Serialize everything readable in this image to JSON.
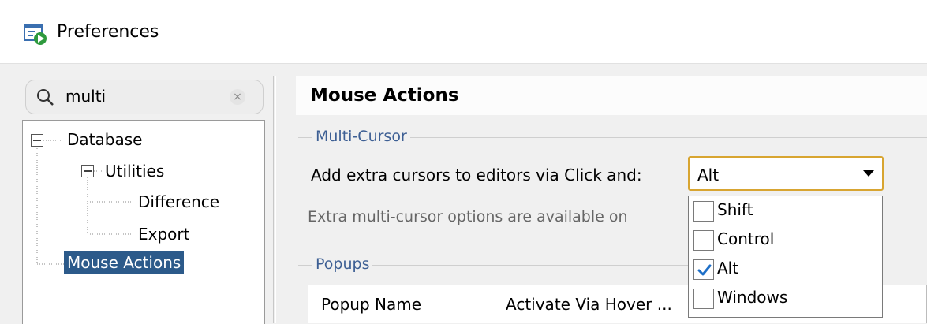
{
  "window": {
    "title": "Preferences",
    "icon": "preferences-app-icon"
  },
  "search": {
    "value": "multi",
    "clear_icon": "×"
  },
  "tree": {
    "items": [
      {
        "label": "Database",
        "expander": "minus"
      },
      {
        "label": "Utilities",
        "expander": "minus"
      },
      {
        "label": "Difference"
      },
      {
        "label": "Export"
      },
      {
        "label": "Mouse Actions",
        "selected": true
      }
    ]
  },
  "main": {
    "title": "Mouse Actions",
    "multi_cursor": {
      "section_label": "Multi-Cursor",
      "field_label": "Add extra cursors to editors via Click and:",
      "selected_value": "Alt",
      "info_text": "Extra multi-cursor options are available on",
      "options": [
        {
          "label": "Shift",
          "checked": false
        },
        {
          "label": "Control",
          "checked": false
        },
        {
          "label": "Alt",
          "checked": true
        },
        {
          "label": "Windows",
          "checked": false
        }
      ]
    },
    "popups": {
      "section_label": "Popups",
      "columns": [
        "Popup Name",
        "Activate Via Hover ..."
      ]
    }
  },
  "colors": {
    "selection": "#2c5a8a",
    "section_label": "#3d5f94",
    "combo_focus": "#d8a531",
    "check": "#1e6fc7"
  }
}
